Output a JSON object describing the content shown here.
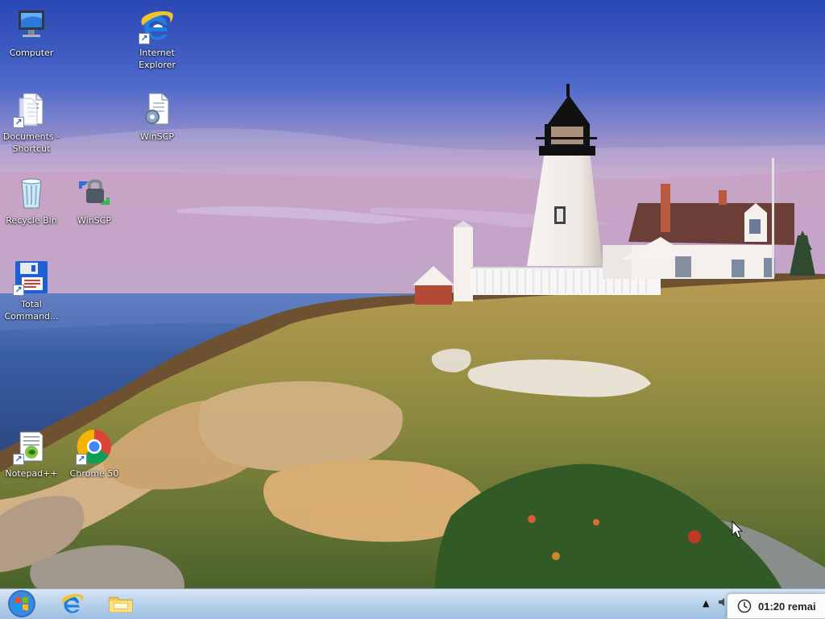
{
  "desktop": {
    "icons": [
      {
        "label": "Computer",
        "icon": "computer-icon"
      },
      {
        "label": "Internet\nExplorer",
        "icon": "internet-explorer-icon"
      },
      {
        "label": "Documents -\nShortcut",
        "icon": "documents-shortcut-icon"
      },
      {
        "label": "WinSCP",
        "icon": "winscp-document-icon"
      },
      {
        "label": "Recycle Bin",
        "icon": "recycle-bin-icon"
      },
      {
        "label": "WinSCP",
        "icon": "winscp-icon"
      },
      {
        "label": "Total\nCommand...",
        "icon": "total-commander-icon"
      },
      {
        "label": "Notepad++",
        "icon": "notepad-plus-plus-icon"
      },
      {
        "label": "Chrome 50",
        "icon": "chrome-icon"
      }
    ]
  },
  "taskbar": {
    "start_icon": "windows-start-icon",
    "pinned": [
      {
        "icon": "internet-explorer-icon"
      },
      {
        "icon": "file-explorer-icon"
      }
    ],
    "tray": {
      "show_hidden_icon": "up-arrow-icon",
      "speaker_icon": "speaker-icon"
    }
  },
  "timer": {
    "text": "01:20 remai",
    "icon": "clock-icon"
  },
  "colors": {
    "taskbar_top": "#d8e6f4",
    "taskbar_bottom": "#9ebfe3",
    "desktop_text": "#ffffff",
    "timer_bg": "#fcfcfc"
  }
}
